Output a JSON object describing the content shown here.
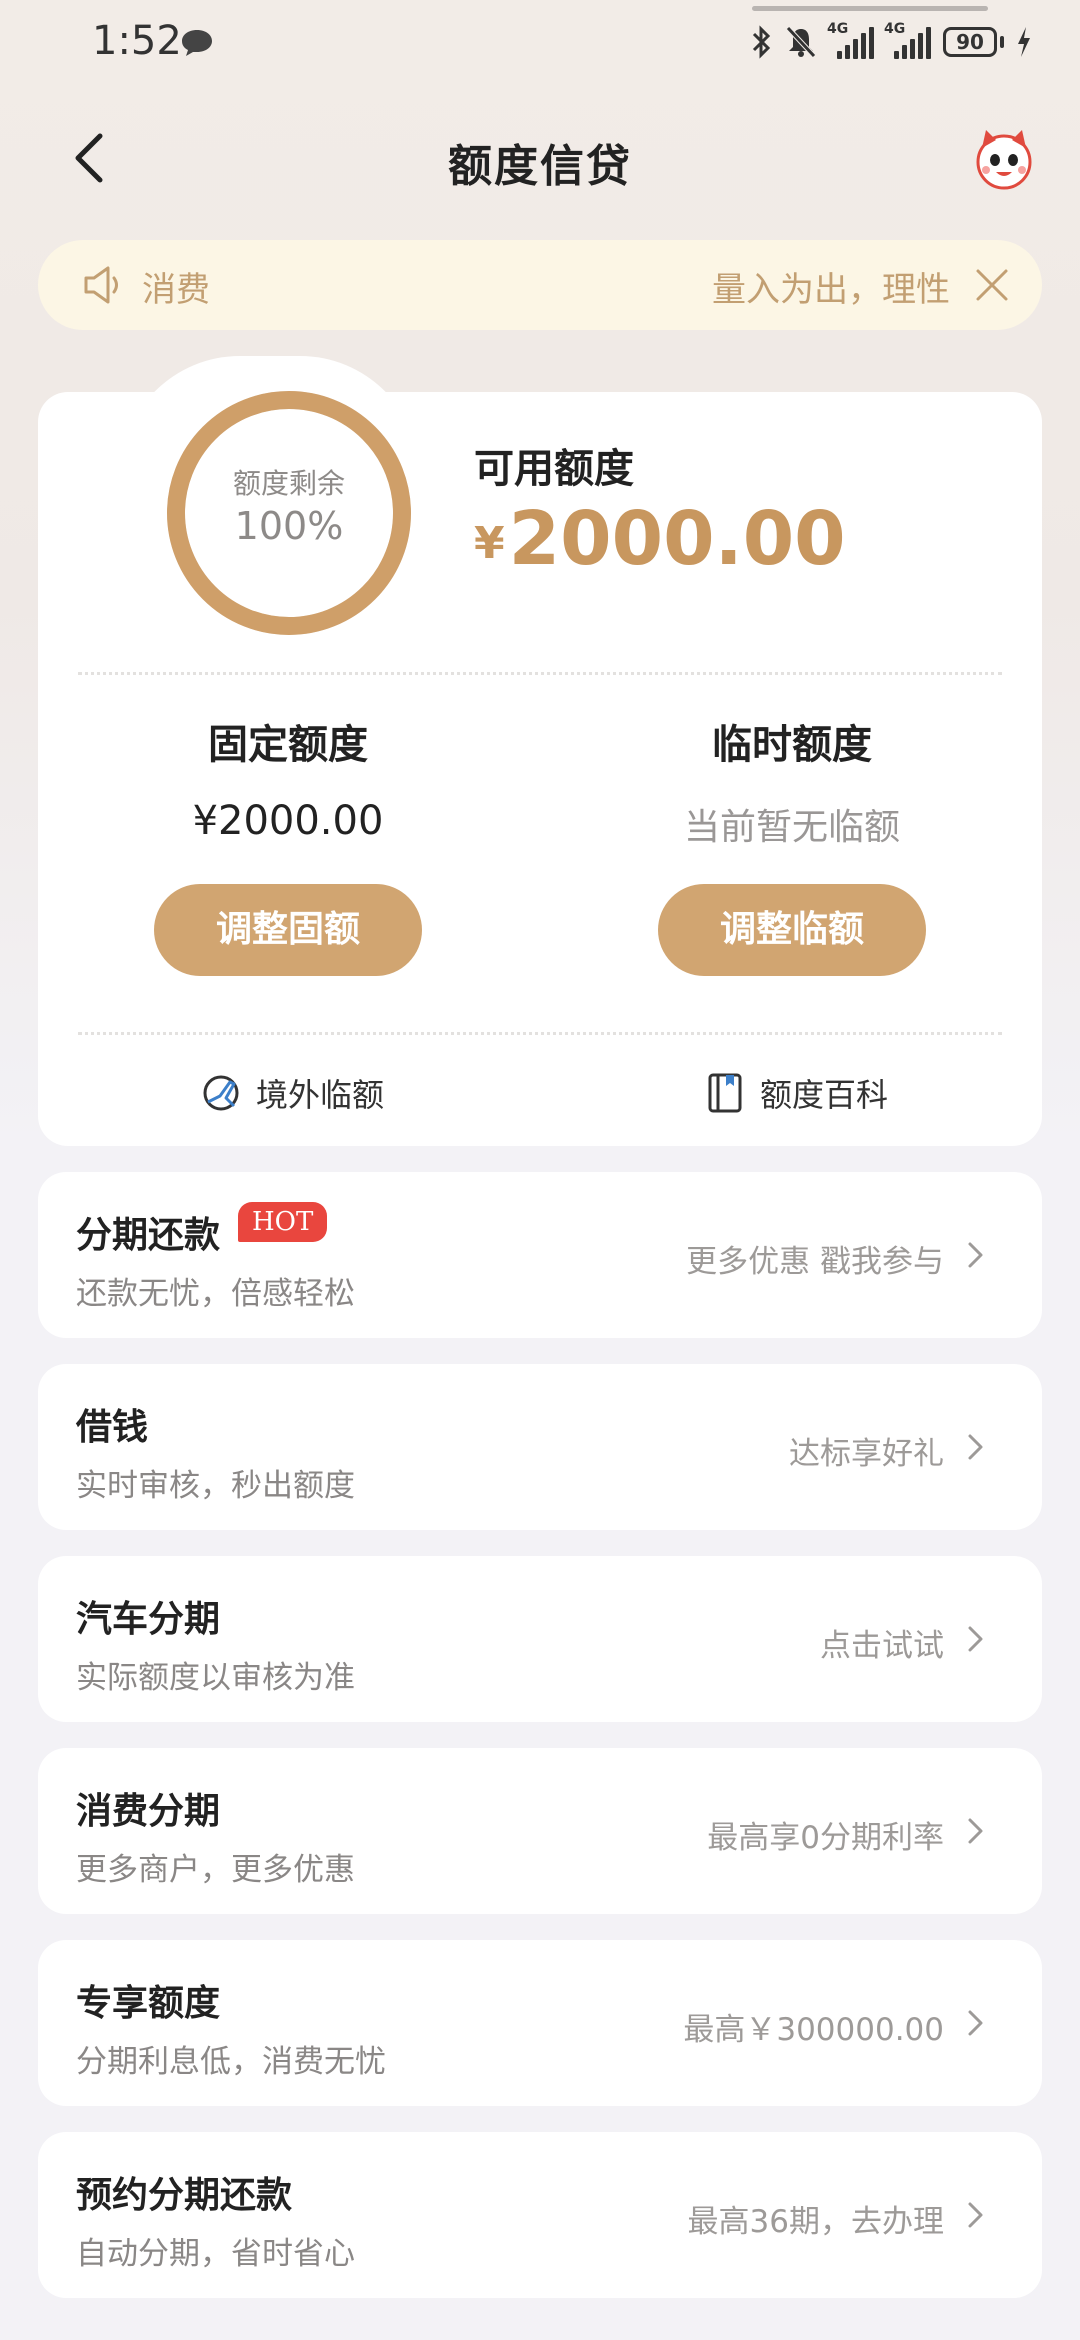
{
  "status_bar": {
    "time": "1:52",
    "network_1": "4G",
    "network_2": "4G",
    "battery": "90"
  },
  "header": {
    "title": "额度信贷"
  },
  "notice": {
    "label": "消费",
    "message": "量入为出，理性"
  },
  "credit": {
    "ring_label": "额度剩余",
    "ring_percent": "100%",
    "ring_fraction": 1.0,
    "available_label": "可用额度",
    "available_currency": "¥",
    "available_amount": "2000.00",
    "fixed": {
      "title": "固定额度",
      "value": "¥2000.00",
      "button": "调整固额"
    },
    "temporary": {
      "title": "临时额度",
      "value": "当前暂无临额",
      "button": "调整临额"
    },
    "links": {
      "overseas": "境外临额",
      "wiki": "额度百科"
    }
  },
  "services": [
    {
      "title": "分期还款",
      "badge": "HOT",
      "subtitle": "还款无忧，倍感轻松",
      "right": "更多优惠 戳我参与"
    },
    {
      "title": "借钱",
      "subtitle": "实时审核，秒出额度",
      "right": "达标享好礼"
    },
    {
      "title": "汽车分期",
      "subtitle": "实际额度以审核为准",
      "right": "点击试试"
    },
    {
      "title": "消费分期",
      "subtitle": "更多商户，更多优惠",
      "right": "最高享0分期利率"
    },
    {
      "title": "专享额度",
      "subtitle": "分期利息低，消费无忧",
      "right": "最高￥300000.00"
    },
    {
      "title": "预约分期还款",
      "subtitle": "自动分期，省时省心",
      "right": "最高36期，去办理"
    }
  ],
  "colors": {
    "accent": "#c8975f",
    "button": "#d1a571",
    "notice_bg": "#fcf6e5",
    "hot": "#e9463e"
  }
}
